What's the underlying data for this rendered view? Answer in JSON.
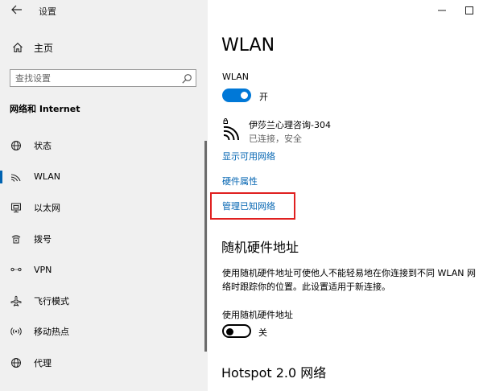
{
  "window": {
    "back_icon": "back-arrow-icon",
    "app_title": "设置",
    "controls": [
      "minimize-icon",
      "maximize-icon"
    ]
  },
  "sidebar": {
    "home_label": "主页",
    "search_placeholder": "查找设置",
    "section_title": "网络和 Internet",
    "items": [
      {
        "label": "状态",
        "icon": "globe-icon"
      },
      {
        "label": "WLAN",
        "icon": "wifi-icon",
        "active": true
      },
      {
        "label": "以太网",
        "icon": "ethernet-icon"
      },
      {
        "label": "拨号",
        "icon": "dialup-icon"
      },
      {
        "label": "VPN",
        "icon": "vpn-icon"
      },
      {
        "label": "飞行模式",
        "icon": "airplane-icon"
      },
      {
        "label": "移动热点",
        "icon": "hotspot-icon"
      },
      {
        "label": "代理",
        "icon": "proxy-globe-icon"
      }
    ]
  },
  "main": {
    "title": "WLAN",
    "wlan_toggle": {
      "label": "WLAN",
      "state_text": "开",
      "on": true
    },
    "network": {
      "name": "伊莎兰心理咨询-304",
      "status": "已连接，安全"
    },
    "links": {
      "show_available": "显示可用网络",
      "hardware_props": "硬件属性",
      "manage_known": "管理已知网络"
    },
    "random_hw": {
      "heading": "随机硬件地址",
      "description": "使用随机硬件地址可使他人不能轻易地在你连接到不同 WLAN 网络时跟踪你的位置。此设置适用于新连接。",
      "toggle_label": "使用随机硬件地址",
      "state_text": "关",
      "on": false
    },
    "hotspot_heading": "Hotspot 2.0 网络"
  },
  "colors": {
    "accent": "#0078d7",
    "link": "#0063b1",
    "highlight": "#e02020",
    "sidebar_bg": "#f0f0f0"
  }
}
